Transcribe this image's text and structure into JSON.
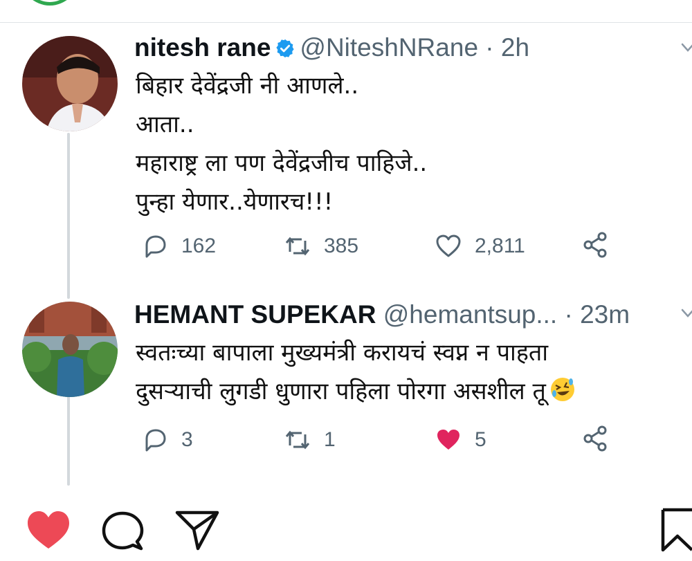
{
  "tweets": [
    {
      "author_name": "nitesh rane",
      "handle": "@NiteshNRane",
      "separator": "·",
      "time": "2h",
      "verified": true,
      "lines": [
        "बिहार देवेंद्रजी नी आणले..",
        "आता..",
        "महाराष्ट्र ला पण देवेंद्रजीच पाहिजे..",
        "पुन्हा येणार..येणारच!!!"
      ],
      "replies": "162",
      "retweets": "385",
      "likes": "2,811",
      "liked": false
    },
    {
      "author_name": "HEMANT SUPEKAR",
      "handle": "@hemantsup...",
      "separator": "·",
      "time": "23m",
      "verified": false,
      "lines": [
        "स्वतःच्या बापाला मुख्यमंत्री करायचं स्वप्न न पाहता",
        "दुसऱ्याची लुगडी धुणारा पहिला पोरगा असशील तू"
      ],
      "replies": "3",
      "retweets": "1",
      "likes": "5",
      "liked": true,
      "trailing_emoji": "rolling-on-floor-laughing-emoji"
    }
  ],
  "icons": {
    "reply": "reply-icon",
    "retweet": "retweet-icon",
    "like": "heart-icon",
    "share": "share-icon",
    "verified": "verified-badge-icon",
    "menu": "chevron-down-icon"
  },
  "colors": {
    "like_active": "#e0245e",
    "insta_like": "#ed4956",
    "verified": "#1d9bf0",
    "muted": "#536471"
  },
  "bottom_bar": {
    "icons": [
      "like-heart-icon",
      "comment-icon",
      "share-direct-icon",
      "bookmark-icon"
    ],
    "liked": true
  }
}
